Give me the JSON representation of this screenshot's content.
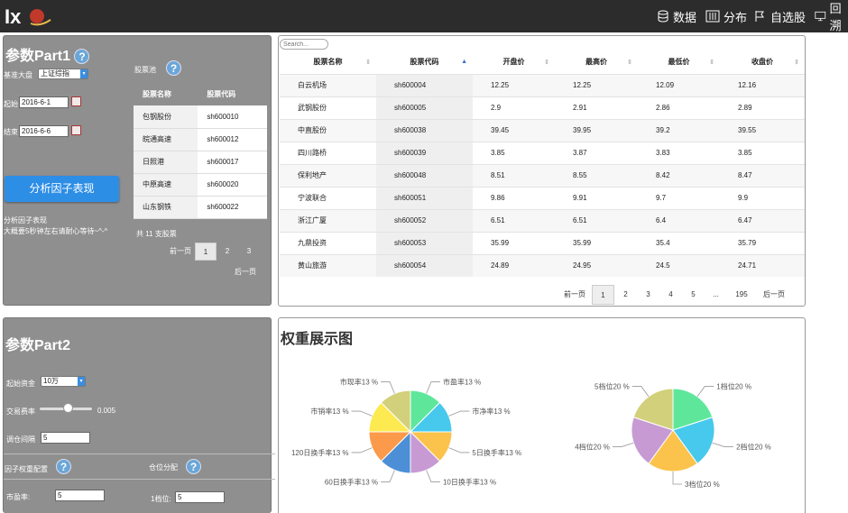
{
  "nav": {
    "data": "数据",
    "dist": "分布",
    "watch": "自选股",
    "backtest": "回溯"
  },
  "part1": {
    "title": "参数Part1",
    "benchmark_label": "基准大盘",
    "benchmark_value": "上证综指",
    "pool_label": "股票池",
    "start_label": "起始",
    "start_value": "2016-6-1",
    "end_label": "结束",
    "end_value": "2016-6-6",
    "analyze_button": "分析因子表现",
    "note1": "分析因子表现",
    "note2": "大概要5秒钟左右请耐心等待~^-^",
    "pool_headers": [
      "股票名称",
      "股票代码"
    ],
    "pool_rows": [
      [
        "包钢股份",
        "sh600010"
      ],
      [
        "皖通高速",
        "sh600012"
      ],
      [
        "日照港",
        "sh600017"
      ],
      [
        "中原高速",
        "sh600020"
      ],
      [
        "山东钢铁",
        "sh600022"
      ]
    ],
    "pool_count": "共 11 支股票",
    "pool_prev": "前一页",
    "pool_pages": [
      "1",
      "2",
      "3"
    ],
    "pool_next": "后一页"
  },
  "stock_table": {
    "search_placeholder": "Search...",
    "headers": [
      "股票名称",
      "股票代码",
      "开盘价",
      "最高价",
      "最低价",
      "收盘价"
    ],
    "rows": [
      [
        "白云机场",
        "sh600004",
        "12.25",
        "12.25",
        "12.09",
        "12.16"
      ],
      [
        "武钢股份",
        "sh600005",
        "2.9",
        "2.91",
        "2.86",
        "2.89"
      ],
      [
        "中直股份",
        "sh600038",
        "39.45",
        "39.95",
        "39.2",
        "39.55"
      ],
      [
        "四川路桥",
        "sh600039",
        "3.85",
        "3.87",
        "3.83",
        "3.85"
      ],
      [
        "保利地产",
        "sh600048",
        "8.51",
        "8.55",
        "8.42",
        "8.47"
      ],
      [
        "宁波联合",
        "sh600051",
        "9.86",
        "9.91",
        "9.7",
        "9.9"
      ],
      [
        "浙江广厦",
        "sh600052",
        "6.51",
        "6.51",
        "6.4",
        "6.47"
      ],
      [
        "九鼎投资",
        "sh600053",
        "35.99",
        "35.99",
        "35.4",
        "35.79"
      ],
      [
        "黄山旅游",
        "sh600054",
        "24.89",
        "24.95",
        "24.5",
        "24.71"
      ]
    ],
    "pager": [
      "前一页",
      "1",
      "2",
      "3",
      "4",
      "5",
      "...",
      "195",
      "后一页"
    ]
  },
  "part2": {
    "title": "参数Part2",
    "capital_label": "起始资金",
    "capital_value": "10万",
    "fee_label": "交易费率",
    "fee_value": "0.005",
    "rebalance_label": "调仓间隔",
    "rebalance_value": "5",
    "factor_weight_label": "因子权重配置",
    "position_label": "仓位分配",
    "pe_label": "市盈率:",
    "pe_value": "5",
    "pos1_label": "1档位:",
    "pos1_value": "5"
  },
  "weights": {
    "title": "权重展示图"
  },
  "chart_data": [
    {
      "type": "pie",
      "labels": [
        "市盈率13 %",
        "市净率13 %",
        "5日换手率13 %",
        "10日换手率13 %",
        "60日换手率13 %",
        "120日换手率13 %",
        "市销率13 %",
        "市现率13 %"
      ],
      "values": [
        13,
        13,
        13,
        13,
        13,
        13,
        13,
        13
      ],
      "colors": [
        "#5ee79a",
        "#46c9ec",
        "#fbc34c",
        "#c79ad4",
        "#4d8fd6",
        "#fb9a4a",
        "#fde950",
        "#d2d07a"
      ]
    },
    {
      "type": "pie",
      "labels": [
        "1档位20 %",
        "2档位20 %",
        "3档位20 %",
        "4档位20 %",
        "5档位20 %"
      ],
      "values": [
        20,
        20,
        20,
        20,
        20
      ],
      "colors": [
        "#5ee79a",
        "#46c9ec",
        "#fbc34c",
        "#c79ad4",
        "#d2d07a"
      ]
    }
  ]
}
